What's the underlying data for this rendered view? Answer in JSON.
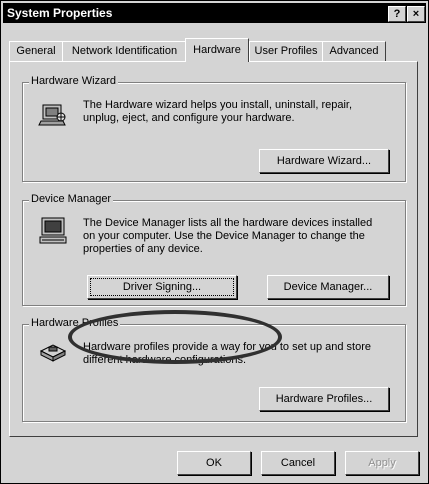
{
  "window": {
    "title": "System Properties",
    "help_btn": "?",
    "close_btn": "×"
  },
  "tabs": [
    {
      "label": "General"
    },
    {
      "label": "Network Identification"
    },
    {
      "label": "Hardware"
    },
    {
      "label": "User Profiles"
    },
    {
      "label": "Advanced"
    }
  ],
  "active_tab": "Hardware",
  "hardware_wizard": {
    "legend": "Hardware Wizard",
    "text": "The Hardware wizard helps you install, uninstall, repair, unplug, eject, and configure your hardware.",
    "button": "Hardware Wizard...",
    "icon": "hardware-wizard-icon"
  },
  "device_manager": {
    "legend": "Device Manager",
    "text": "The Device Manager lists all the hardware devices installed on your computer. Use the Device Manager to change the properties of any device.",
    "driver_button": "Driver Signing...",
    "device_button": "Device Manager...",
    "icon": "computer-icon"
  },
  "hardware_profiles": {
    "legend": "Hardware Profiles",
    "text": "Hardware profiles provide a way for you to set up and store different hardware configurations.",
    "button": "Hardware Profiles...",
    "icon": "hardware-profiles-icon"
  },
  "footer": {
    "ok": "OK",
    "cancel": "Cancel",
    "apply": "Apply"
  },
  "colors": {
    "titlebar": "#000000",
    "face": "#d4d4d4",
    "highlight_ring": "#303030"
  }
}
